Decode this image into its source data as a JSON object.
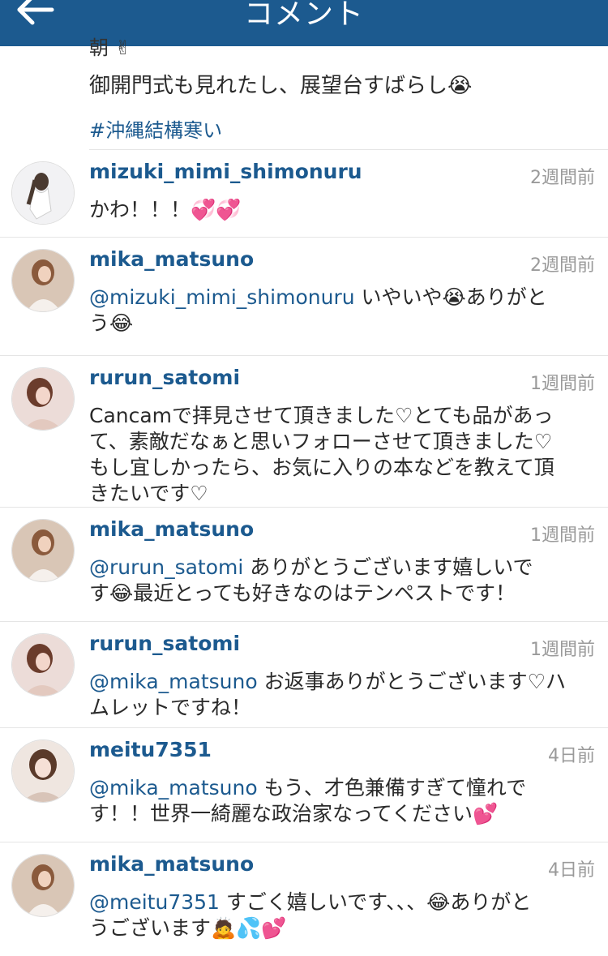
{
  "header": {
    "title": "コメント",
    "back_icon": "back-arrow-icon"
  },
  "caption": {
    "text": "御開門式も見れたし、展望台すばらし😭",
    "hashtag": "#沖縄結構寒い"
  },
  "comments": [
    {
      "user": "mizuki_mimi_shimonuru",
      "time": "2週間前",
      "text": "かわ！！！💞💞"
    },
    {
      "user": "mika_matsuno",
      "time": "2週間前",
      "mention": "@mizuki_mimi_shimonuru",
      "text_line1": " いやいや😭ありがと",
      "text_line2": "う😂"
    },
    {
      "user": "rurun_satomi",
      "time": "1週間前",
      "lines": [
        "Cancamで拝見させて頂きました♡とても品があっ",
        "て、素敵だなぁと思いフォローさせて頂きました♡",
        "もし宜しかったら、お気に入りの本などを教えて頂",
        "きたいです♡"
      ]
    },
    {
      "user": "mika_matsuno",
      "time": "1週間前",
      "mention": "@rurun_satomi",
      "text_line1": " ありがとうございます嬉しいで",
      "text_line2": "す😂最近とっても好きなのはテンペストです！"
    },
    {
      "user": "rurun_satomi",
      "time": "1週間前",
      "mention": "@mika_matsuno",
      "text_line1": " お返事ありがとうございます♡ハ",
      "text_line2": "ムレットですね！"
    },
    {
      "user": "meitu7351",
      "time": "4日前",
      "mention": "@mika_matsuno",
      "text_line1": " もう、才色兼備すぎて憧れで",
      "text_line2": "す！！世界一綺麗な政治家なってください💕"
    },
    {
      "user": "mika_matsuno",
      "time": "4日前",
      "mention": "@meitu7351",
      "text_line1": " すごく嬉しいです、、、😂ありがと",
      "text_line2": "うございます🙇💦💕"
    }
  ]
}
